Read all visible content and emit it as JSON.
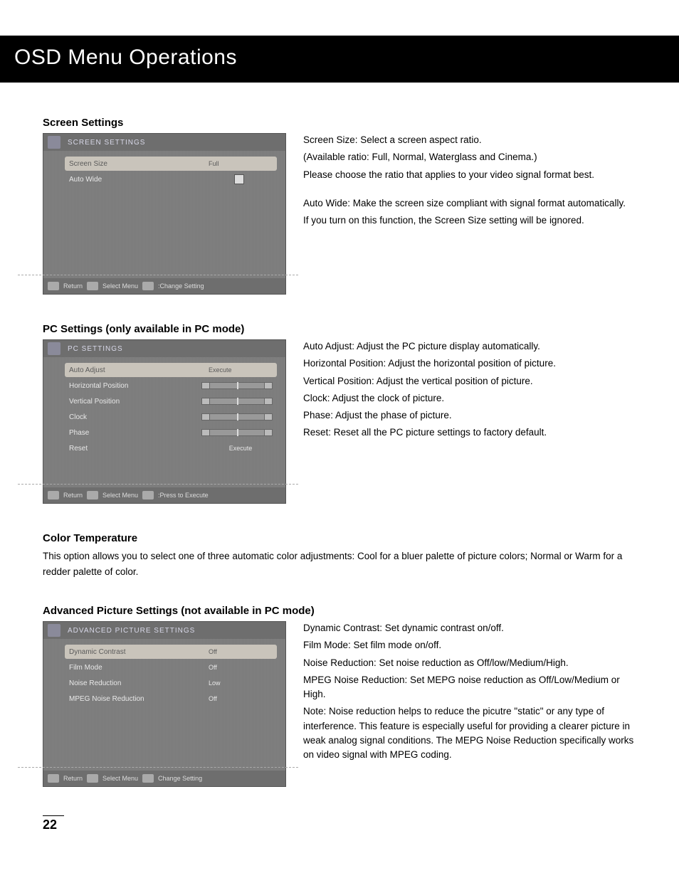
{
  "page_title": "OSD Menu Operations",
  "page_number": "22",
  "sections": {
    "screen": {
      "title": "Screen Settings",
      "osd": {
        "header": "SCREEN SETTINGS",
        "items": [
          {
            "label": "Screen Size",
            "value": "Full",
            "selected": true
          },
          {
            "label": "Auto Wide",
            "value": "",
            "checkbox": true
          }
        ],
        "footer": {
          "return": "Return",
          "select": "Select Menu",
          "change": ":Change Setting"
        }
      },
      "desc": {
        "p1": "Screen Size: Select a screen aspect ratio.",
        "p2": "(Available ratio: Full, Normal, Waterglass and Cinema.)",
        "p3": "Please choose the ratio that applies to your video signal format best.",
        "p4": "Auto Wide: Make the screen size compliant with signal format automatically.",
        "p5": "If you turn on this function, the Screen Size setting will be ignored."
      }
    },
    "pc": {
      "title": "PC Settings (only available in PC mode)",
      "osd": {
        "header": "PC SETTINGS",
        "items": [
          {
            "label": "Auto Adjust",
            "value": "Execute",
            "selected": true
          },
          {
            "label": "Horizontal Position",
            "slider": true
          },
          {
            "label": "Vertical Position",
            "slider": true
          },
          {
            "label": "Clock",
            "slider": true
          },
          {
            "label": "Phase",
            "slider": true
          },
          {
            "label": "Reset",
            "value": "Execute"
          }
        ],
        "footer": {
          "return": "Return",
          "select": "Select Menu",
          "change": ":Press to Execute"
        }
      },
      "desc": {
        "p1": "Auto Adjust: Adjust the PC picture display automatically.",
        "p2": "Horizontal Position: Adjust the horizontal position of picture.",
        "p3": "Vertical Position: Adjust the vertical position of picture.",
        "p4": "Clock: Adjust the clock of picture.",
        "p5": "Phase: Adjust the phase of picture.",
        "p6": "Reset: Reset all the PC picture settings to factory default."
      }
    },
    "color": {
      "title": "Color Temperature",
      "body": "This option allows you to select one of three automatic color adjustments: Cool for a bluer palette of picture colors; Normal or Warm for a redder palette of color."
    },
    "advanced": {
      "title": "Advanced Picture Settings (not available in PC mode)",
      "osd": {
        "header": "ADVANCED PICTURE SETTINGS",
        "items": [
          {
            "label": "Dynamic Contrast",
            "value": "Off",
            "selected": true
          },
          {
            "label": "Film Mode",
            "value": "Off"
          },
          {
            "label": "Noise Reduction",
            "value": "Low"
          },
          {
            "label": "MPEG Noise Reduction",
            "value": "Off"
          }
        ],
        "footer": {
          "return": "Return",
          "select": "Select Menu",
          "change": "Change Setting"
        }
      },
      "desc": {
        "p1": "Dynamic Contrast: Set dynamic contrast on/off.",
        "p2": "Film Mode: Set film mode on/off.",
        "p3": "Noise Reduction: Set noise reduction as Off/low/Medium/High.",
        "p4": "MPEG Noise Reduction: Set MEPG noise reduction as Off/Low/Medium or High.",
        "p5": "Note: Noise reduction helps to reduce the picutre \"static\" or any type of interference. This feature is especially useful for providing a clearer picture in weak analog signal conditions. The MEPG Noise Reduction specifically works on video signal with MPEG coding."
      }
    }
  }
}
